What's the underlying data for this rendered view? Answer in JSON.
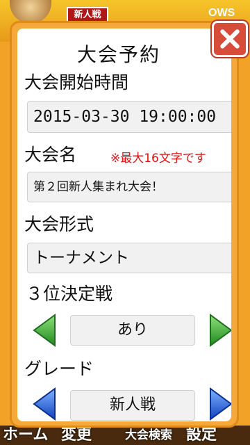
{
  "background": {
    "tag_label": "新人戦",
    "tag_right": "OWS",
    "nav": [
      "ホーム",
      "変更",
      "大会検索",
      "設定"
    ]
  },
  "dialog": {
    "title": "大会予約",
    "start_time": {
      "label": "大会開始時間",
      "value": "2015-03-30 19:00:00"
    },
    "name": {
      "label": "大会名",
      "warning": "※最大16文字です",
      "value": "第２回新人集まれ大会！"
    },
    "format": {
      "label": "大会形式",
      "value": "トーナメント"
    },
    "third_place": {
      "label": "３位決定戦",
      "value": "あり"
    },
    "grade": {
      "label": "グレード",
      "value": "新人戦"
    }
  },
  "colors": {
    "accent_orange": "#f4a93a",
    "close_red": "#d84c3a",
    "arrow_green": "#3aa63a",
    "arrow_blue": "#1f5bd8",
    "warning_red": "#e01212"
  },
  "icons": {
    "close": "close-x-icon",
    "prev_green": "arrow-left-icon",
    "next_green": "arrow-right-icon",
    "prev_blue": "arrow-left-icon",
    "next_blue": "arrow-right-icon"
  }
}
